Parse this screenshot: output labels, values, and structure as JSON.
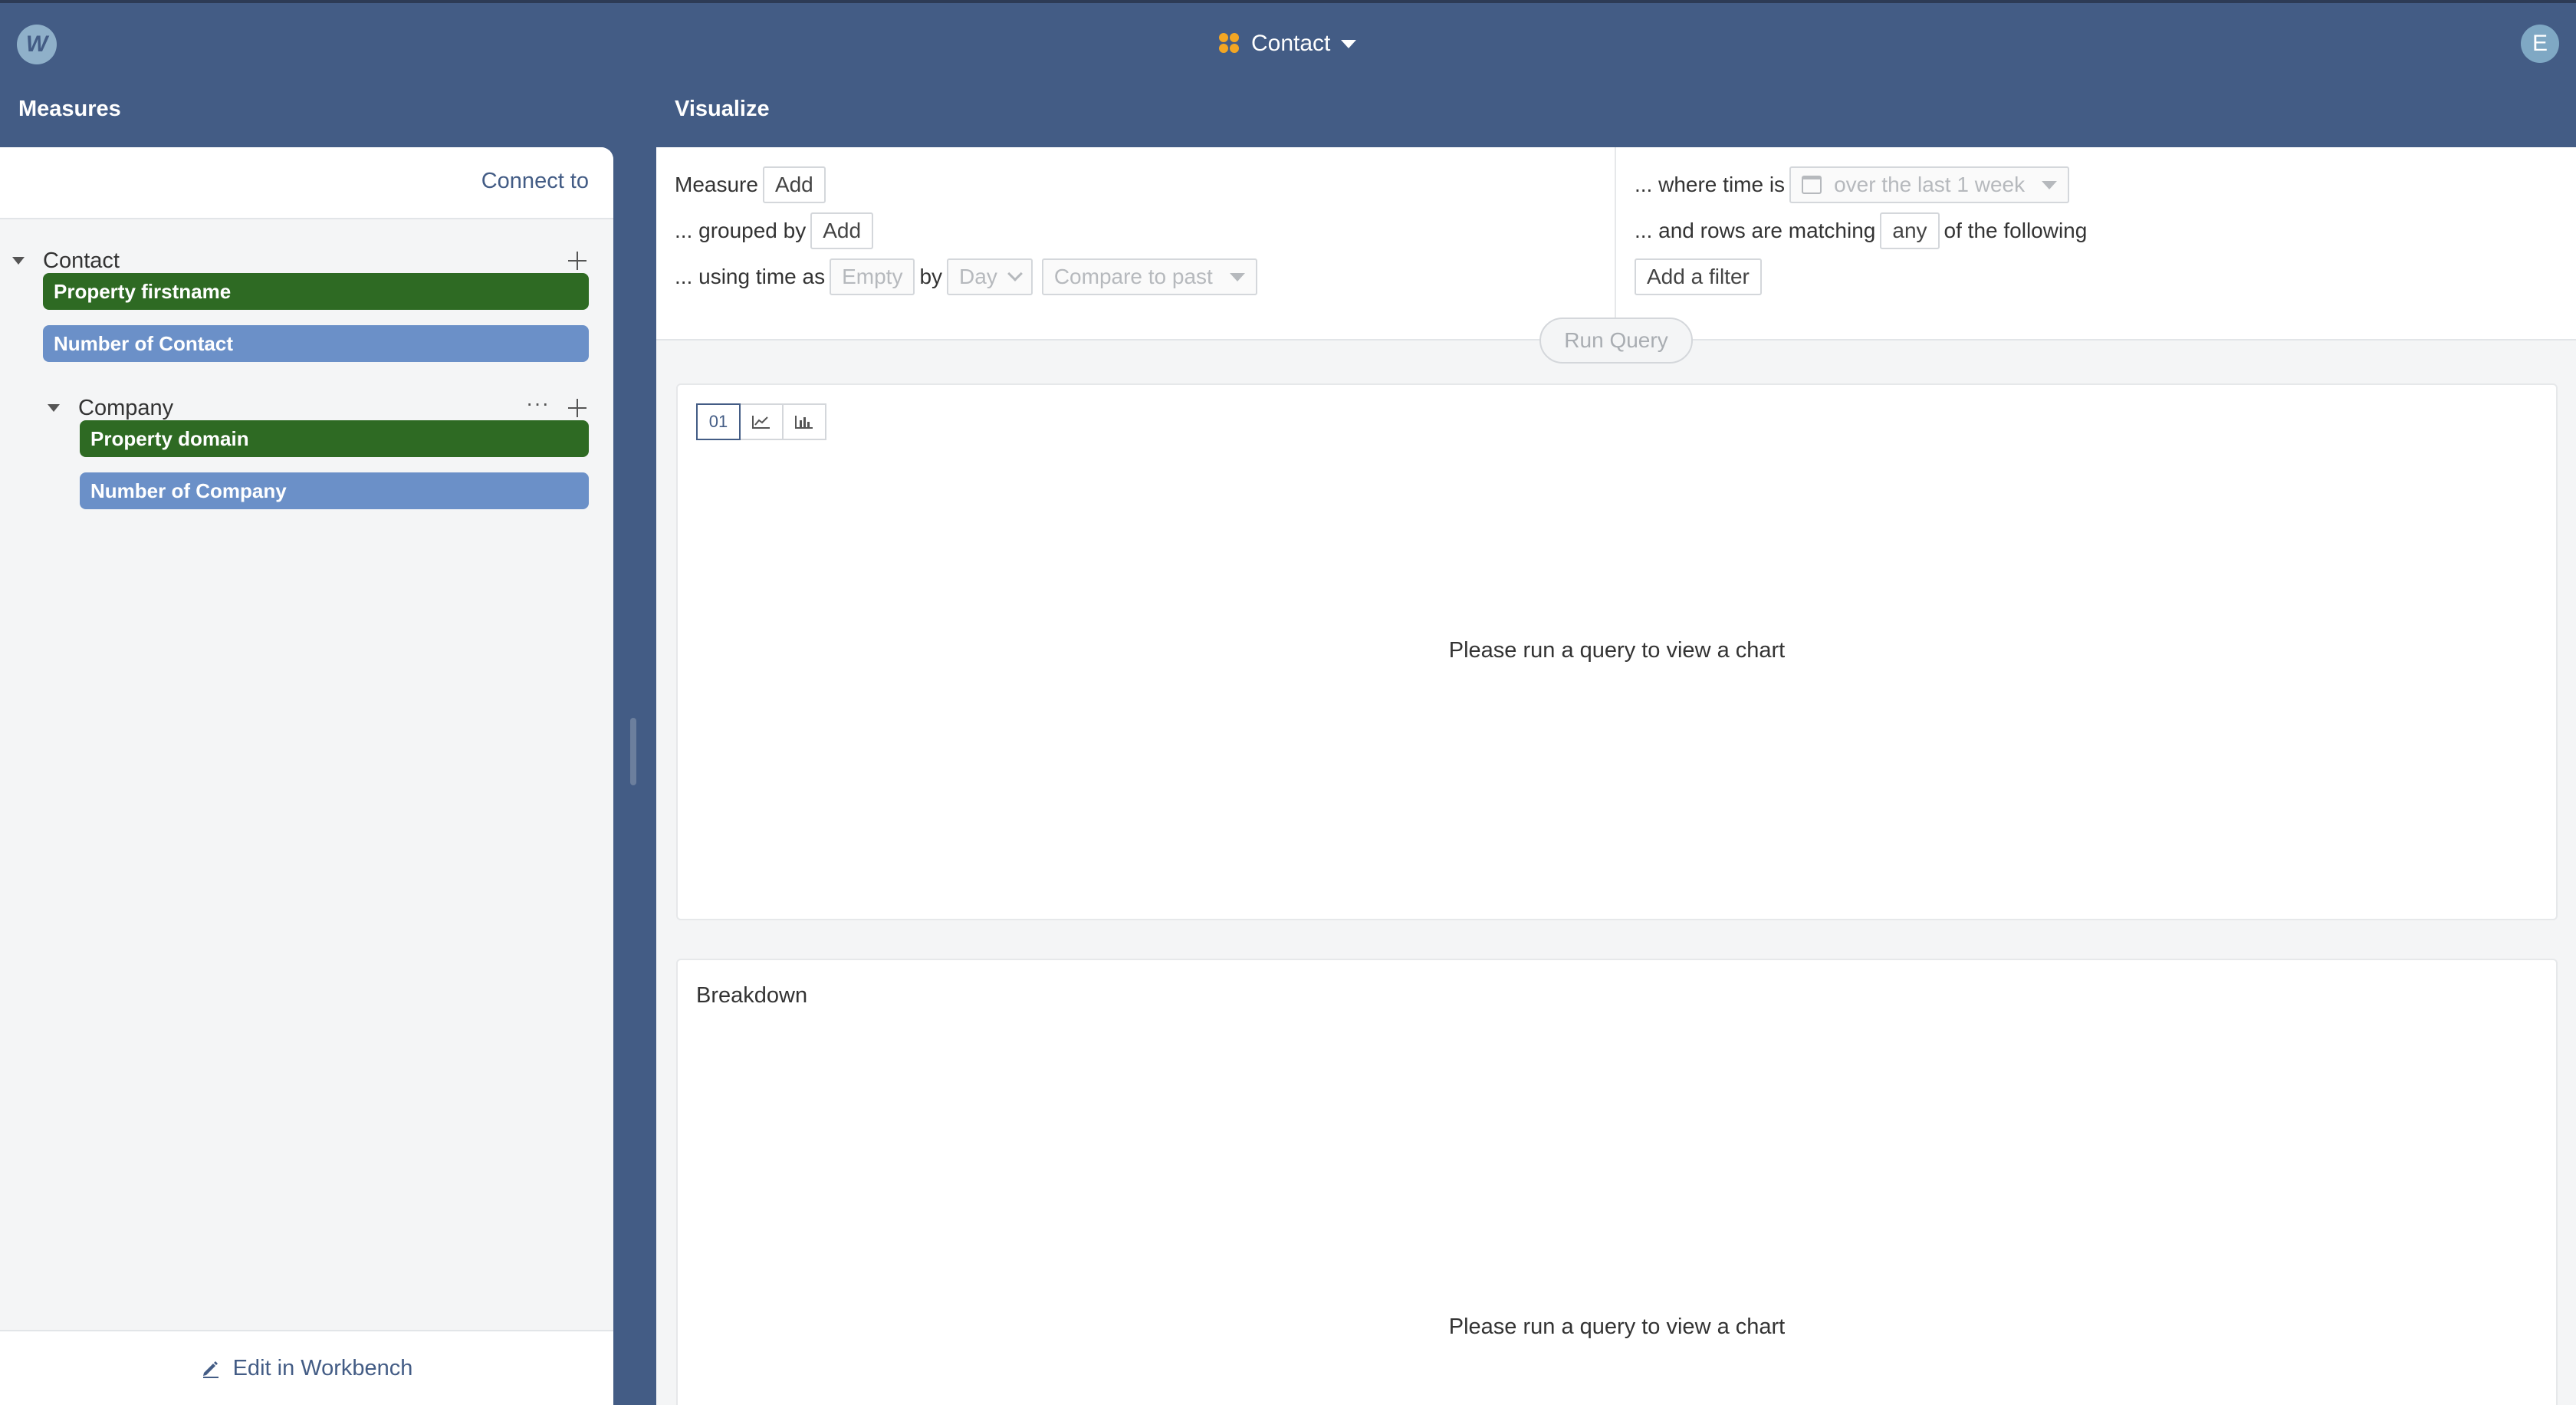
{
  "header": {
    "logo_text": "W",
    "title": "Contact",
    "avatar_initial": "E",
    "accent_color": "#435c85",
    "model_icon": "cube-cluster-icon"
  },
  "left": {
    "section_label": "Measures",
    "connect_label": "Connect to",
    "tree": {
      "root_label": "Contact",
      "pills": [
        {
          "label": "Property firstname",
          "kind": "property",
          "color": "#2e6a23"
        },
        {
          "label": "Number of Contact",
          "kind": "measure",
          "color": "#6b90c8"
        }
      ],
      "child": {
        "label": "Company",
        "more_label": "···",
        "pills": [
          {
            "label": "Property domain",
            "kind": "property",
            "color": "#2e6a23"
          },
          {
            "label": "Number of Company",
            "kind": "measure",
            "color": "#6b90c8"
          }
        ]
      }
    },
    "footer_label": "Edit in Workbench"
  },
  "right": {
    "section_label": "Visualize",
    "query": {
      "measure_label": "Measure",
      "measure_add": "Add",
      "grouped_label": "... grouped by",
      "grouped_add": "Add",
      "time_label": "... using time as",
      "time_value": "Empty",
      "by_label": "by",
      "granularity": "Day",
      "compare": "Compare to past",
      "where_label": "... where time is",
      "time_range": "over the last 1 week",
      "rows_label": "... and rows are matching",
      "match_value": "any",
      "following_label": "of the following",
      "add_filter": "Add a filter"
    },
    "run_query": "Run Query",
    "chart_card": {
      "toggle_number_label": "01",
      "placeholder": "Please run a query to view a chart"
    },
    "breakdown_card": {
      "title": "Breakdown",
      "placeholder": "Please run a query to view a chart"
    }
  }
}
